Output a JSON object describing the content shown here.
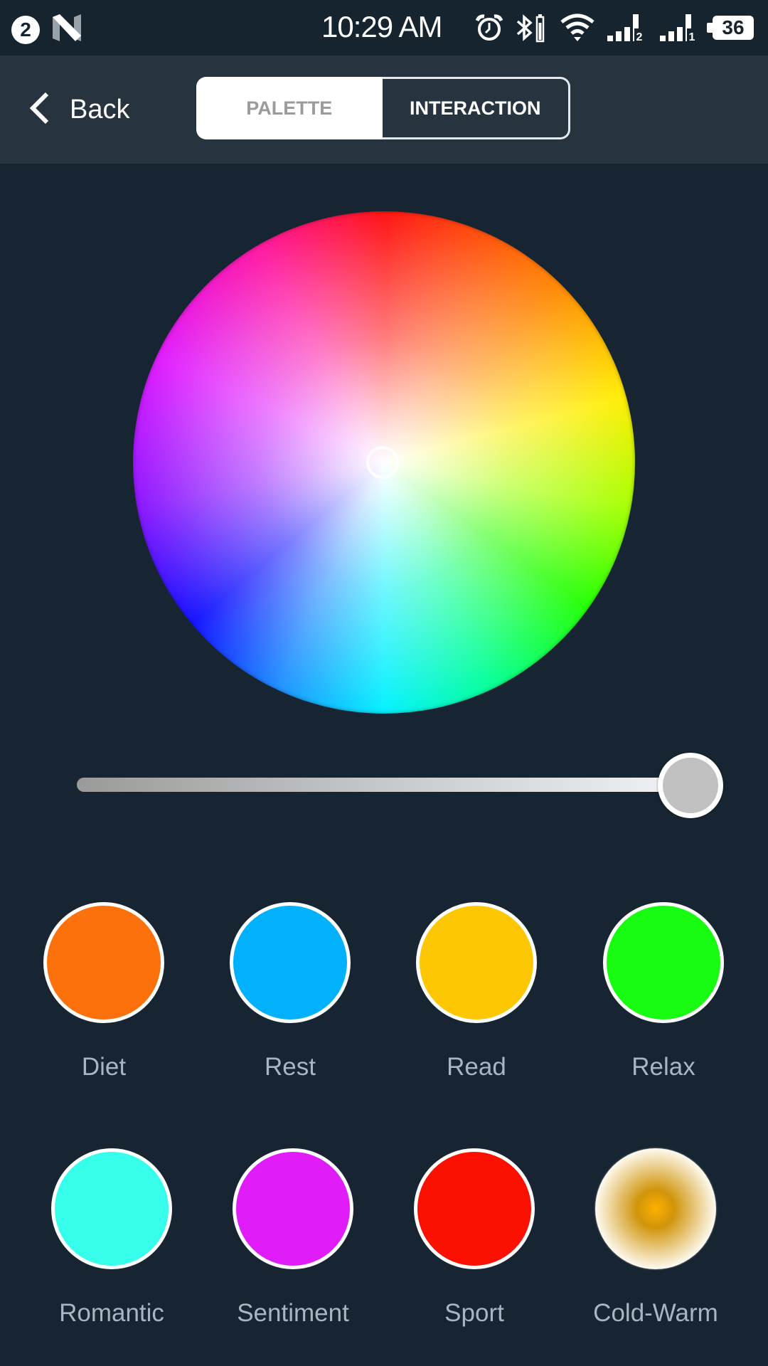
{
  "status_bar": {
    "notification_count": "2",
    "time": "10:29 AM",
    "icons": [
      "notification-badge-icon",
      "n-logo-icon",
      "alarm-icon",
      "bluetooth-icon",
      "vibrate-battery-icon",
      "wifi-icon",
      "signal-sim2-icon",
      "signal-sim1-icon"
    ],
    "sim2_label": "2",
    "sim1_label": "1",
    "battery_level": "36"
  },
  "header": {
    "back_label": "Back",
    "tabs": [
      {
        "label": "PALETTE",
        "selected": true
      },
      {
        "label": "INTERACTION",
        "selected": false
      }
    ]
  },
  "color_wheel": {
    "selected_color": "#ffffff"
  },
  "brightness_slider": {
    "value_percent": 100
  },
  "presets": [
    {
      "label": "Diet",
      "color": "#fd710c"
    },
    {
      "label": "Rest",
      "color": "#02b1fb"
    },
    {
      "label": "Read",
      "color": "#fdc704"
    },
    {
      "label": "Relax",
      "color": "#17fc10"
    },
    {
      "label": "Romantic",
      "color": "#37fdeb"
    },
    {
      "label": "Sentiment",
      "color": "#e01df9"
    },
    {
      "label": "Sport",
      "color": "#fc1001"
    },
    {
      "label": "Cold-Warm",
      "color_center": "#ffb000",
      "color_edge": "#fffdf6"
    }
  ]
}
